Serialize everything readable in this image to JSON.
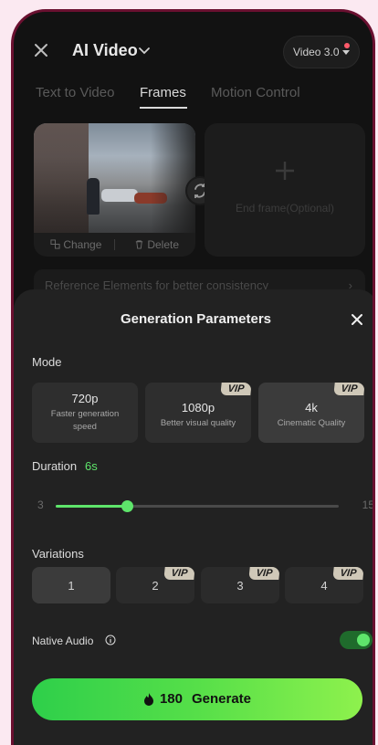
{
  "header": {
    "title": "AI Video",
    "model": "Video 3.0"
  },
  "tabs": [
    {
      "label": "Text to Video"
    },
    {
      "label": "Frames"
    },
    {
      "label": "Motion Control"
    }
  ],
  "frames": {
    "change_label": "Change",
    "delete_label": "Delete",
    "end_frame_label": "End frame(Optional)",
    "reference_label": "Reference Elements for better consistency"
  },
  "sheet": {
    "title": "Generation Parameters",
    "mode_label": "Mode",
    "modes": [
      {
        "title": "720p",
        "subtitle": "Faster generation speed",
        "vip": ""
      },
      {
        "title": "1080p",
        "subtitle": "Better visual quality",
        "vip": "VIP"
      },
      {
        "title": "4k",
        "subtitle": "Cinematic Quality",
        "vip": "VIP"
      }
    ],
    "duration_label": "Duration",
    "duration_value": "6s",
    "duration_min": "3",
    "duration_max": "15",
    "duration_level": 0.25,
    "variations_label": "Variations",
    "variations": [
      {
        "label": "1",
        "vip": ""
      },
      {
        "label": "2",
        "vip": "VIP"
      },
      {
        "label": "3",
        "vip": "VIP"
      },
      {
        "label": "4",
        "vip": "VIP"
      }
    ],
    "native_audio_label": "Native Audio",
    "native_audio_on": true,
    "generate_cost": "180",
    "generate_label": "Generate"
  },
  "colors": {
    "accent": "#5ee56b",
    "vip_badge": "#cfc8b8"
  }
}
